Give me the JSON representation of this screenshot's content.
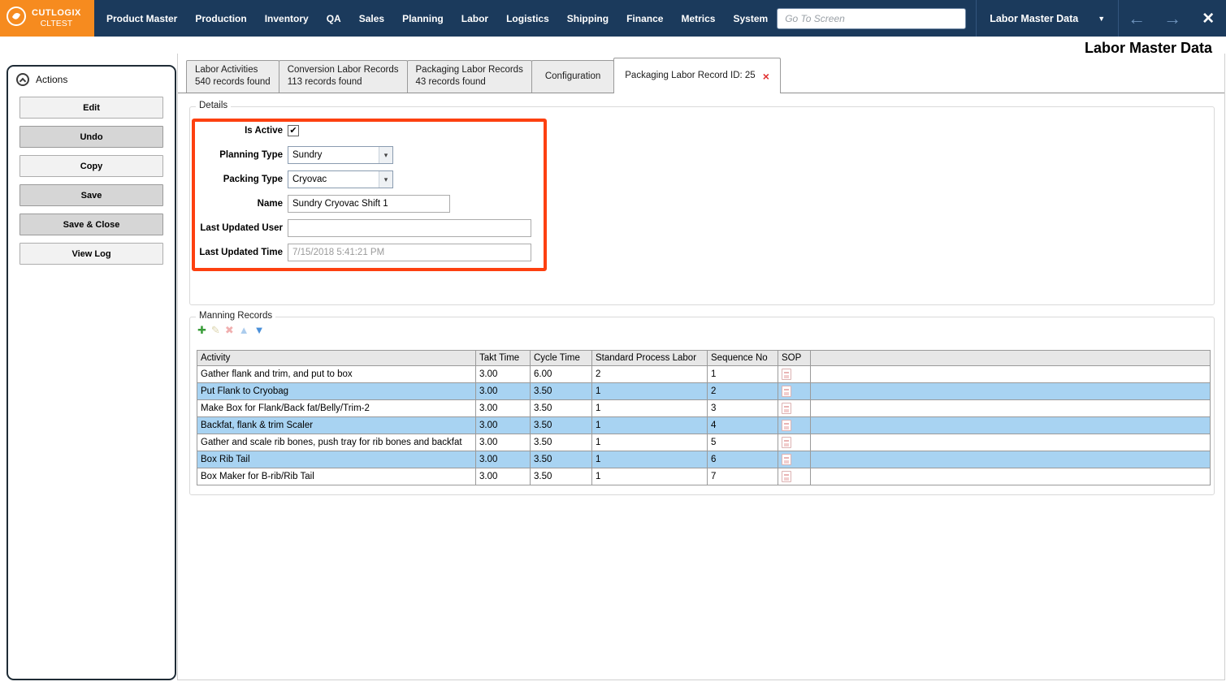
{
  "topbar": {
    "brand": {
      "line1": "CUTLOGIX",
      "line2": "CLTEST"
    },
    "menu": [
      "Product Master",
      "Production",
      "Inventory",
      "QA",
      "Sales",
      "Planning",
      "Labor",
      "Logistics",
      "Shipping",
      "Finance",
      "Metrics",
      "System"
    ],
    "search_placeholder": "Go To Screen",
    "screen_selector": "Labor Master Data",
    "colors": {
      "bar": "#1b3a5c",
      "brand_bg": "#f68b1f"
    }
  },
  "icons": {
    "back": "←",
    "forward": "→",
    "close": "×",
    "favorite": "★",
    "caret_down": "▼",
    "combo_caret": "▾",
    "checkbox_check": "✔",
    "tab_close": "×"
  },
  "page": {
    "title": "Labor Master Data"
  },
  "actions_panel": {
    "title": "Actions",
    "buttons": [
      {
        "label": "Edit",
        "highlighted": false
      },
      {
        "label": "Undo",
        "highlighted": true
      },
      {
        "label": "Copy",
        "highlighted": false
      },
      {
        "label": "Save",
        "highlighted": true
      },
      {
        "label": "Save & Close",
        "highlighted": true
      },
      {
        "label": "View Log",
        "highlighted": false
      }
    ]
  },
  "tabs": [
    {
      "title": "Labor Activities",
      "subtitle": "540 records found",
      "active": false,
      "closable": false
    },
    {
      "title": "Conversion Labor Records",
      "subtitle": "113 records found",
      "active": false,
      "closable": false
    },
    {
      "title": "Packaging Labor Records",
      "subtitle": "43 records found",
      "active": false,
      "closable": false
    },
    {
      "title": "Configuration",
      "active": false,
      "closable": false
    },
    {
      "title": "Packaging Labor Record ID: 25",
      "active": true,
      "closable": true
    }
  ],
  "details": {
    "legend": "Details",
    "annotation_color": "#fd4010",
    "fields": {
      "is_active": {
        "label": "Is Active",
        "checked": true
      },
      "planning_type": {
        "label": "Planning Type",
        "value": "Sundry"
      },
      "packing_type": {
        "label": "Packing Type",
        "value": "Cryovac"
      },
      "name": {
        "label": "Name",
        "value": "Sundry Cryovac Shift 1"
      },
      "last_updated_user": {
        "label": "Last Updated User",
        "value": ""
      },
      "last_updated_time": {
        "label": "Last Updated Time",
        "value": "7/15/2018 5:41:21 PM"
      }
    }
  },
  "manning": {
    "legend": "Manning Records",
    "toolbar": [
      {
        "name": "add-icon",
        "glyph": "✚",
        "color": "#3a9d3a",
        "faded": false
      },
      {
        "name": "edit-icon",
        "glyph": "✎",
        "color": "#b3a24e",
        "faded": true
      },
      {
        "name": "delete-icon",
        "glyph": "✖",
        "color": "#e05050",
        "faded": true
      },
      {
        "name": "move-up-icon",
        "glyph": "▲",
        "color": "#4a90d9",
        "faded": true
      },
      {
        "name": "move-down-icon",
        "glyph": "▼",
        "color": "#4a90d9",
        "faded": false
      }
    ],
    "table": {
      "headers": [
        "Activity",
        "Takt Time",
        "Cycle Time",
        "Standard Process Labor",
        "Sequence No",
        "SOP"
      ],
      "highlight_color": "#a8d3f2",
      "rows": [
        {
          "activity": "Gather flank and trim, and put to box",
          "takt": "3.00",
          "cycle": "6.00",
          "spl": "2",
          "seq": "1"
        },
        {
          "activity": "Put Flank to Cryobag",
          "takt": "3.00",
          "cycle": "3.50",
          "spl": "1",
          "seq": "2"
        },
        {
          "activity": "Make Box for Flank/Back fat/Belly/Trim-2",
          "takt": "3.00",
          "cycle": "3.50",
          "spl": "1",
          "seq": "3"
        },
        {
          "activity": "Backfat, flank & trim Scaler",
          "takt": "3.00",
          "cycle": "3.50",
          "spl": "1",
          "seq": "4"
        },
        {
          "activity": "Gather and scale rib bones, push tray for rib bones and backfat",
          "takt": "3.00",
          "cycle": "3.50",
          "spl": "1",
          "seq": "5"
        },
        {
          "activity": "Box Rib Tail",
          "takt": "3.00",
          "cycle": "3.50",
          "spl": "1",
          "seq": "6"
        },
        {
          "activity": "Box Maker for B-rib/Rib Tail",
          "takt": "3.00",
          "cycle": "3.50",
          "spl": "1",
          "seq": "7"
        }
      ]
    }
  }
}
